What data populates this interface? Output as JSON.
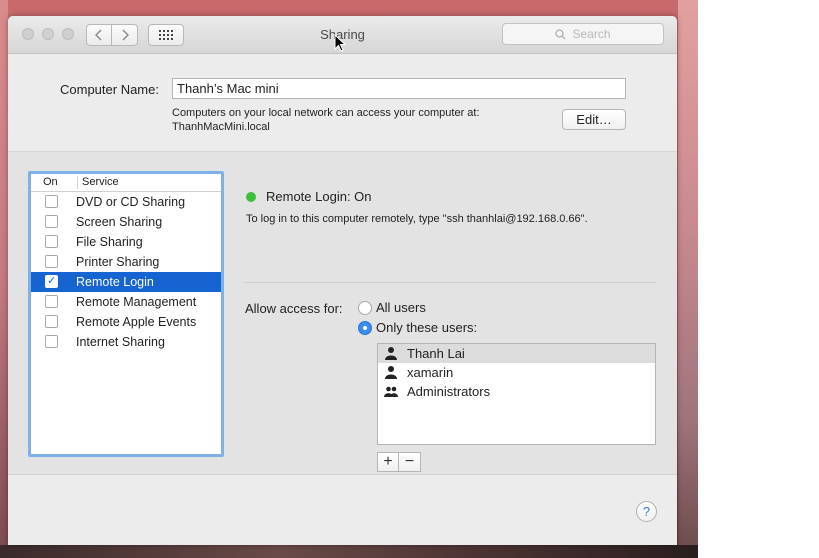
{
  "window": {
    "title": "Sharing",
    "search_placeholder": "Search",
    "nav_back_icon": "chevron-left-icon",
    "nav_forward_icon": "chevron-right-icon",
    "grid_icon": "show-all-grid-icon"
  },
  "computer_name": {
    "label": "Computer Name:",
    "value": "Thanh’s Mac mini",
    "info_line1": "Computers on your local network can access your computer at:",
    "info_line2": "ThanhMacMini.local",
    "edit_button": "Edit…"
  },
  "services": {
    "header_on": "On",
    "header_service": "Service",
    "items": [
      {
        "label": "DVD or CD Sharing",
        "checked": false,
        "selected": false
      },
      {
        "label": "Screen Sharing",
        "checked": false,
        "selected": false
      },
      {
        "label": "File Sharing",
        "checked": false,
        "selected": false
      },
      {
        "label": "Printer Sharing",
        "checked": false,
        "selected": false
      },
      {
        "label": "Remote Login",
        "checked": true,
        "selected": true
      },
      {
        "label": "Remote Management",
        "checked": false,
        "selected": false
      },
      {
        "label": "Remote Apple Events",
        "checked": false,
        "selected": false
      },
      {
        "label": "Internet Sharing",
        "checked": false,
        "selected": false
      }
    ]
  },
  "detail": {
    "status_text": "Remote Login: On",
    "status_color": "#3cbf3a",
    "instructions": "To log in to this computer remotely, type \"ssh thanhlai@192.168.0.66\".",
    "allow_label": "Allow access for:",
    "option_all": "All users",
    "option_only": "Only these users:",
    "selected_option": "only",
    "users": [
      {
        "name": "Thanh Lai",
        "icon": "user-icon",
        "selected": true
      },
      {
        "name": "xamarin",
        "icon": "user-icon",
        "selected": false
      },
      {
        "name": "Administrators",
        "icon": "group-icon",
        "selected": false
      }
    ],
    "add_label": "+",
    "remove_label": "−"
  },
  "help_label": "?",
  "colors": {
    "selection": "#1663d2",
    "focus_ring": "#7fb0e8",
    "radio_on": "#3a8cf0"
  }
}
